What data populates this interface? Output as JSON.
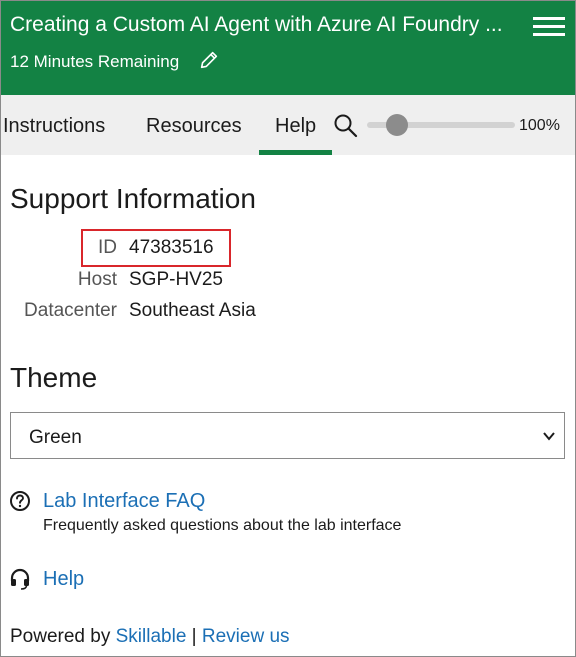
{
  "header": {
    "title": "Creating a Custom AI Agent with Azure AI Foundry ...",
    "timer": "12 Minutes Remaining",
    "menu_icon": "hamburger-menu-icon",
    "edit_icon": "pencil-icon",
    "color": "#138244"
  },
  "tabs": [
    {
      "label": "Instructions",
      "selected": false
    },
    {
      "label": "Resources",
      "selected": false
    },
    {
      "label": "Help",
      "selected": true
    }
  ],
  "zoom": {
    "icon": "magnifier-icon",
    "value": "100%",
    "slider_fraction": 0.2
  },
  "support": {
    "title": "Support Information",
    "rows": [
      {
        "label": "ID",
        "value": "47383516"
      },
      {
        "label": "Host",
        "value": "SGP-HV25"
      },
      {
        "label": "Datacenter",
        "value": "Southeast Asia"
      }
    ],
    "highlight_color": "#d9262b"
  },
  "theme": {
    "title": "Theme",
    "selected": "Green"
  },
  "links": {
    "faq": {
      "label": "Lab Interface FAQ",
      "description": "Frequently asked questions about the lab interface",
      "icon": "question-circle-icon"
    },
    "help": {
      "label": "Help",
      "icon": "headset-icon"
    },
    "link_color": "#1b6fb5"
  },
  "footer": {
    "prefix": "Powered by ",
    "brand": "Skillable",
    "separator": " | ",
    "review": "Review us"
  }
}
